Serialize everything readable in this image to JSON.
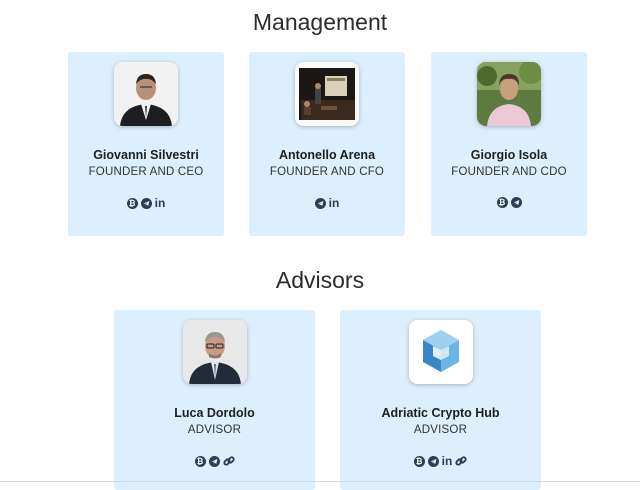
{
  "management": {
    "title": "Management",
    "members": [
      {
        "name": "Giovanni Silvestri",
        "role": "FOUNDER AND CEO",
        "photo": "photo-man-suit",
        "socials": [
          "bitcoin-icon",
          "telegram-icon",
          "linkedin-icon"
        ]
      },
      {
        "name": "Antonello Arena",
        "role": "FOUNDER AND CFO",
        "photo": "photo-conference",
        "socials": [
          "telegram-icon",
          "linkedin-icon"
        ]
      },
      {
        "name": "Giorgio Isola",
        "role": "FOUNDER AND CDO",
        "photo": "photo-man-outdoor",
        "socials": [
          "bitcoin-icon",
          "telegram-icon"
        ]
      }
    ]
  },
  "advisors": {
    "title": "Advisors",
    "members": [
      {
        "name": "Luca Dordolo",
        "role": "ADVISOR",
        "photo": "photo-man-glasses",
        "socials": [
          "bitcoin-icon",
          "telegram-icon",
          "link-icon"
        ]
      },
      {
        "name": "Adriatic Crypto Hub",
        "role": "ADVISOR",
        "photo": "logo-cube",
        "socials": [
          "bitcoin-icon",
          "telegram-icon",
          "linkedin-icon",
          "link-icon"
        ]
      }
    ]
  },
  "icons": {
    "bitcoin_glyph": "₿",
    "linkedin_glyph": "in"
  },
  "colors": {
    "card_bg": "#ddeefc",
    "icon": "#2c3e57"
  }
}
